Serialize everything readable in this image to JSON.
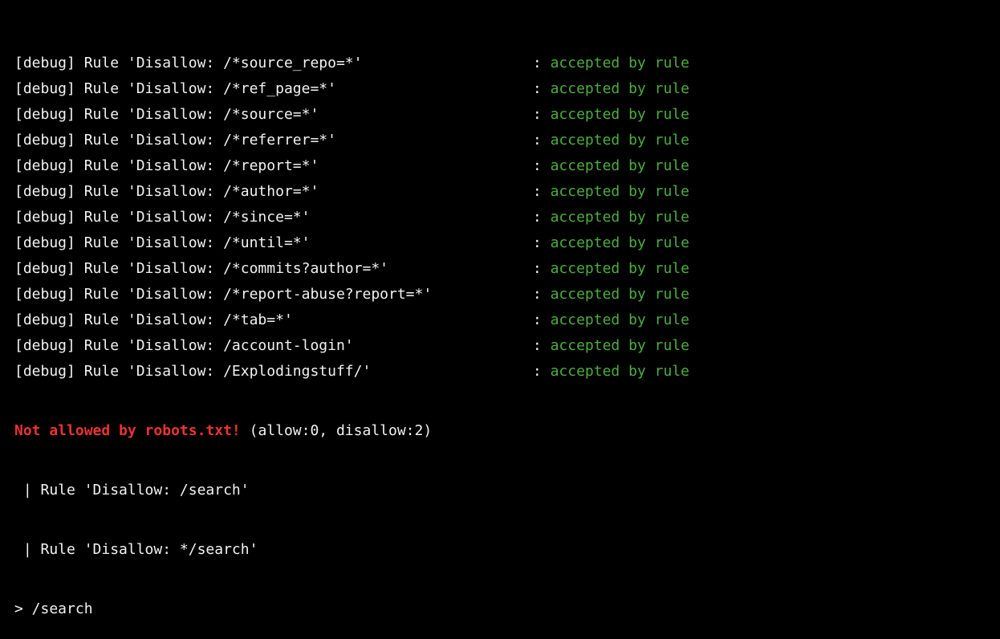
{
  "colors": {
    "accepted": "#4cae3d",
    "error": "#ee3232",
    "text": "#f2f2f2",
    "background": "#000000"
  },
  "debug_lines": [
    {
      "rule": "[debug] Rule 'Disallow: /*source_repo=*'",
      "sep": ": ",
      "status": "accepted by rule"
    },
    {
      "rule": "[debug] Rule 'Disallow: /*ref_page=*'",
      "sep": ": ",
      "status": "accepted by rule"
    },
    {
      "rule": "[debug] Rule 'Disallow: /*source=*'",
      "sep": ": ",
      "status": "accepted by rule"
    },
    {
      "rule": "[debug] Rule 'Disallow: /*referrer=*'",
      "sep": ": ",
      "status": "accepted by rule"
    },
    {
      "rule": "[debug] Rule 'Disallow: /*report=*'",
      "sep": ": ",
      "status": "accepted by rule"
    },
    {
      "rule": "[debug] Rule 'Disallow: /*author=*'",
      "sep": ": ",
      "status": "accepted by rule"
    },
    {
      "rule": "[debug] Rule 'Disallow: /*since=*'",
      "sep": ": ",
      "status": "accepted by rule"
    },
    {
      "rule": "[debug] Rule 'Disallow: /*until=*'",
      "sep": ": ",
      "status": "accepted by rule"
    },
    {
      "rule": "[debug] Rule 'Disallow: /*commits?author=*'",
      "sep": ": ",
      "status": "accepted by rule"
    },
    {
      "rule": "[debug] Rule 'Disallow: /*report-abuse?report=*'",
      "sep": ": ",
      "status": "accepted by rule"
    },
    {
      "rule": "[debug] Rule 'Disallow: /*tab=*'",
      "sep": ": ",
      "status": "accepted by rule"
    },
    {
      "rule": "[debug] Rule 'Disallow: /account-login'",
      "sep": ": ",
      "status": "accepted by rule"
    },
    {
      "rule": "[debug] Rule 'Disallow: /Explodingstuff/'",
      "sep": ": ",
      "status": "accepted by rule"
    }
  ],
  "result": {
    "error": "Not allowed by robots.txt!",
    "counts": " (allow:0, disallow:2)"
  },
  "matched_rules": [
    " | Rule 'Disallow: /search'",
    " | Rule 'Disallow: */search'"
  ],
  "prompt": "> /search"
}
